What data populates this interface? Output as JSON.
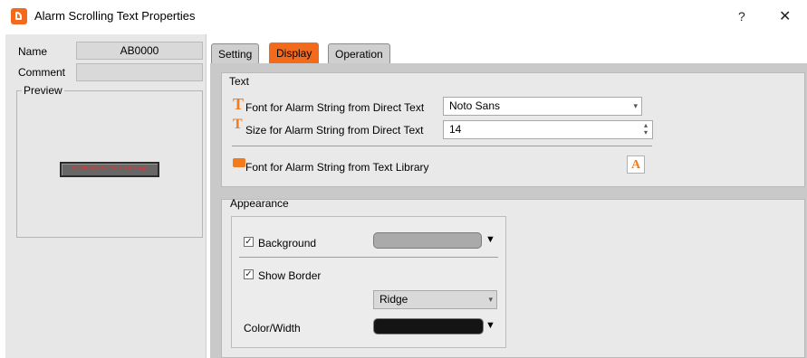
{
  "window": {
    "title": "Alarm Scrolling Text Properties",
    "help": "?",
    "close": "✕"
  },
  "left": {
    "name_label": "Name",
    "name_value": "AB0000",
    "comment_label": "Comment",
    "comment_value": "",
    "preview_label": "Preview",
    "preview_text": "Cy/MM/dd) hh:mm:ss Message"
  },
  "tabs": [
    {
      "label": "Setting",
      "active": false
    },
    {
      "label": "Display",
      "active": true
    },
    {
      "label": "Operation",
      "active": false
    }
  ],
  "text_group": {
    "legend": "Text",
    "font_direct_label": "Font for Alarm String from Direct Text",
    "font_direct_value": "Noto Sans",
    "size_direct_label": "Size for Alarm String from Direct Text",
    "size_direct_value": "14",
    "font_library_label": "Font for Alarm String from Text Library"
  },
  "appearance": {
    "legend": "Appearance",
    "background_label": "Background",
    "background_checked": true,
    "background_color": "#aaaaaa",
    "show_border_label": "Show Border",
    "show_border_checked": true,
    "border_style_value": "Ridge",
    "color_width_label": "Color/Width",
    "border_color": "#141414"
  },
  "colors": {
    "accent": "#f26b1d",
    "preview_text": "#e8312f"
  }
}
